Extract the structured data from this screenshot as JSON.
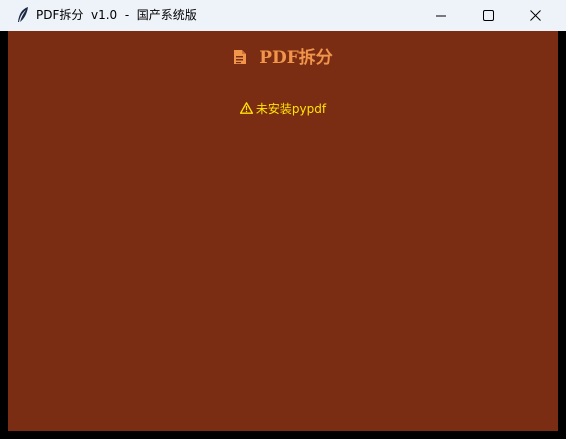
{
  "window": {
    "title": "PDF拆分  v1.0  -  国产系统版",
    "icon": "feather-icon"
  },
  "controls": {
    "minimize_icon": "minimize-icon",
    "maximize_icon": "maximize-icon",
    "close_icon": "close-icon"
  },
  "main": {
    "heading": "PDF拆分",
    "heading_icon": "document-icon",
    "warning_text": "未安装pypdf",
    "warning_icon": "warning-icon"
  },
  "colors": {
    "background": "#7b2d14",
    "heading": "#f0954a",
    "warning": "#ffe400",
    "titlebar": "#eef2f9"
  }
}
